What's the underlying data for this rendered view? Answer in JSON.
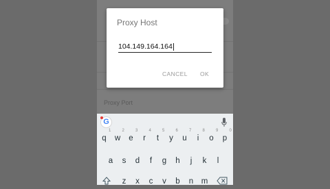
{
  "background_settings": {
    "items": [
      "Proxy Port"
    ]
  },
  "dialog": {
    "title": "Proxy Host",
    "input_value": "104.149.164.164",
    "cancel_label": "CANCEL",
    "ok_label": "OK"
  },
  "keyboard": {
    "toolbar": {
      "google_icon": "google-g-icon",
      "mic_icon": "mic-icon"
    },
    "row1": [
      "q",
      "w",
      "e",
      "r",
      "t",
      "y",
      "u",
      "i",
      "o",
      "p"
    ],
    "row1_hints": [
      "1",
      "2",
      "3",
      "4",
      "5",
      "6",
      "7",
      "8",
      "9",
      "0"
    ],
    "row2": [
      "a",
      "s",
      "d",
      "f",
      "g",
      "h",
      "j",
      "k",
      "l"
    ],
    "row3": [
      "z",
      "x",
      "c",
      "v",
      "b",
      "n",
      "m"
    ],
    "shift_icon": "shift-icon",
    "backspace_icon": "backspace-icon"
  },
  "colors": {
    "dim_background": "#6b6b6b",
    "dialog_bg": "#ffffff",
    "keyboard_bg": "#eceff1",
    "text_primary": "#111111",
    "button_text": "#9a9a9a"
  }
}
